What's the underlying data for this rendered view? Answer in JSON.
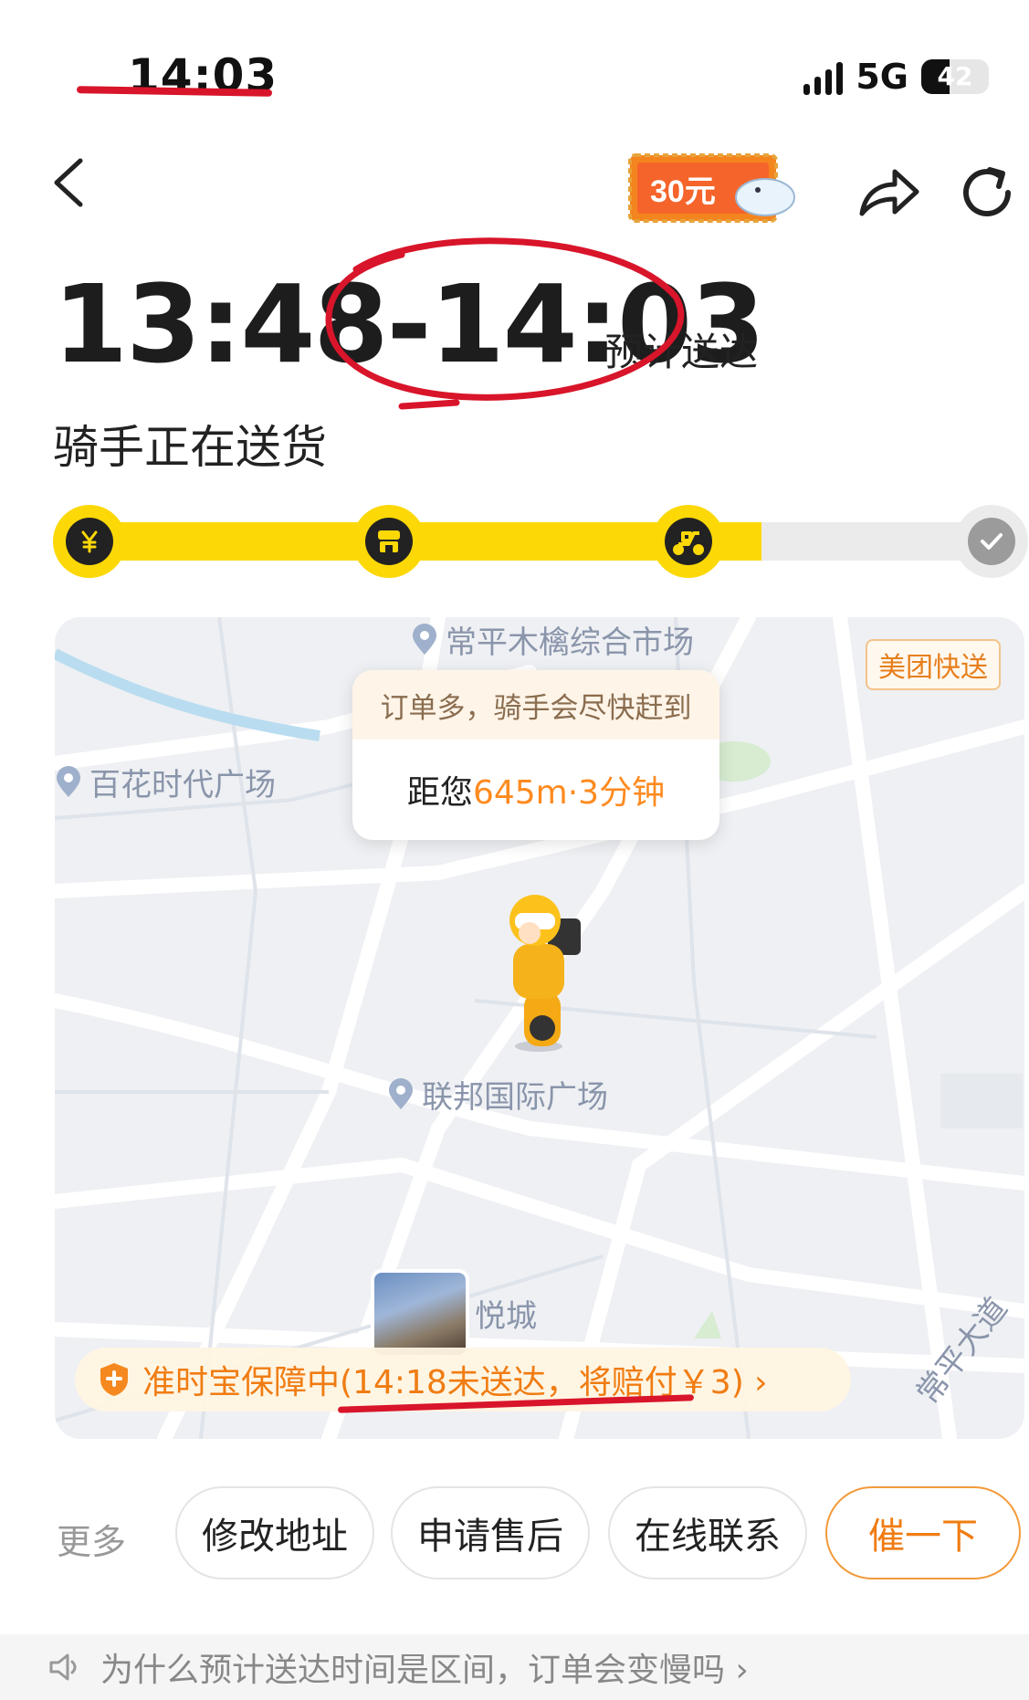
{
  "status_bar": {
    "time": "14:03",
    "network": "5G",
    "battery": "42",
    "battery_level": 0.42
  },
  "header": {
    "back_icon": "chevron-left-icon",
    "promo_label": "30元",
    "share_icon": "share-icon",
    "refresh_icon": "refresh-icon"
  },
  "delivery": {
    "eta_range": "13:48-14:03",
    "eta_suffix": "预计送达",
    "status": "骑手正在送货",
    "progress_fraction": 0.73,
    "steps": [
      {
        "icon": "yen-icon",
        "state": "done"
      },
      {
        "icon": "store-icon",
        "state": "done"
      },
      {
        "icon": "scooter-icon",
        "state": "current"
      },
      {
        "icon": "check-icon",
        "state": "pending"
      }
    ]
  },
  "map": {
    "brand_tag": "美团快送",
    "pois": [
      "常平木檎综合市场",
      "百花时代广场",
      "联邦国际广场",
      "悦城"
    ],
    "road_label": "常平大道",
    "popup": {
      "header": "订单多，骑手会尽快赶到",
      "distance_prefix": "距您",
      "distance_value": "645m·3分钟"
    },
    "guarantee": "准时宝保障中(14:18未送达，将赔付￥3) ›"
  },
  "actions": {
    "more": "更多",
    "buttons": [
      "修改地址",
      "申请售后",
      "在线联系",
      "催一下"
    ]
  },
  "tip": {
    "text": "为什么预计送达时间是区间，订单会变慢吗 ›"
  },
  "colors": {
    "accent_yellow": "#fcd807",
    "accent_orange": "#f07c12",
    "annotation_red": "#d8152a"
  }
}
